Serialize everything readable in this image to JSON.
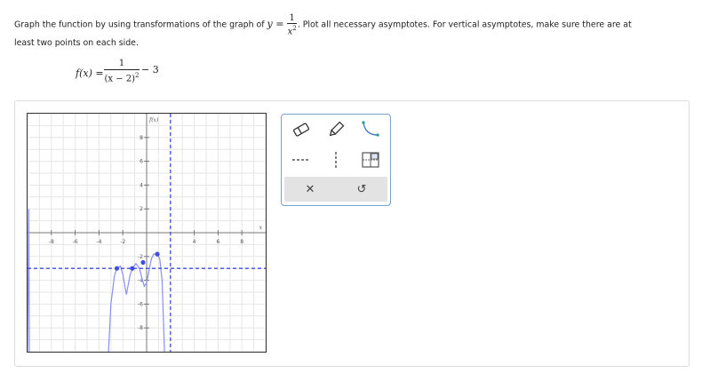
{
  "question": {
    "part1": "Graph the function by using transformations of the graph of ",
    "y_eq": "y =",
    "frac_num": "1",
    "frac_den": "x",
    "frac_den_exp": "2",
    "part2": ". Plot all necessary asymptotes. For vertical asymptotes, make sure there are at",
    "line2": "least two points on each side."
  },
  "function_def": {
    "lhs": "f(x) =",
    "numerator": "1",
    "denominator": "(x − 2)",
    "denominator_exp": "2",
    "tail": "− 3"
  },
  "graph": {
    "xlabel": "x",
    "ylabel": "f(x)",
    "x_ticks": [
      "-8",
      "-6",
      "-4",
      "-2",
      "4",
      "6",
      "8"
    ],
    "y_ticks": [
      "8",
      "6",
      "4",
      "2",
      "-2",
      "-4",
      "-6",
      "-8"
    ],
    "x_range": [
      -10,
      10
    ],
    "y_range": [
      -10,
      10
    ],
    "horizontal_asymptote_y": -3,
    "vertical_asymptote_x": 2,
    "plotted_points": [
      [
        -2.5,
        -3
      ],
      [
        -1.2,
        -3
      ],
      [
        -0.3,
        -2.5
      ],
      [
        0.9,
        -1.8
      ]
    ],
    "curve_color": "#8a8ef0",
    "asymptote_color": "#3f4fe0",
    "point_color": "#3f4fe0"
  },
  "toolbox": {
    "eraser_icon": "eraser-icon",
    "pencil_icon": "pencil-icon",
    "curve_icon": "curve-icon",
    "hasym_icon": "horizontal-asymptote-icon",
    "vasym_icon": "vertical-asymptote-icon",
    "grid_icon": "grid-icon",
    "clear_label": "✕",
    "undo_label": "↺"
  }
}
